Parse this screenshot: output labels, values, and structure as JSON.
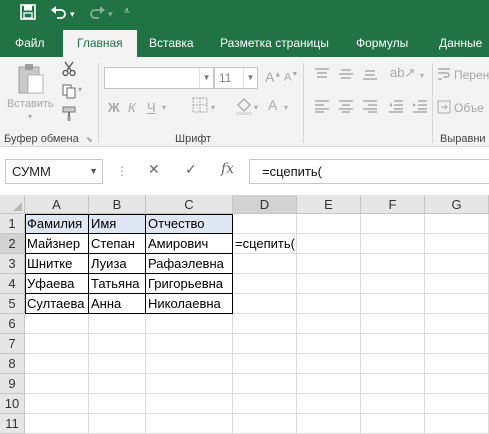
{
  "quick_access": {
    "save": "save-icon",
    "undo": "undo-icon",
    "redo": "redo-icon",
    "customize": "customize-icon"
  },
  "tabs": [
    "Файл",
    "Главная",
    "Вставка",
    "Разметка страницы",
    "Формулы",
    "Данные"
  ],
  "active_tab": "Главная",
  "ribbon": {
    "clipboard": {
      "paste_label": "Вставить",
      "group_label": "Буфер обмена"
    },
    "font": {
      "font_name": "",
      "font_size": "11",
      "bold": "Ж",
      "italic": "К",
      "underline": "Ч",
      "group_label": "Шрифт"
    },
    "alignment": {
      "wrap_label": "Перен",
      "merge_label": "Объе",
      "group_label": "Выравни"
    }
  },
  "formula_bar": {
    "name_box": "СУММ",
    "cancel": "✕",
    "enter": "✓",
    "fx": "fx",
    "formula": "=сцепить("
  },
  "columns": [
    "A",
    "B",
    "C",
    "D",
    "E",
    "F",
    "G"
  ],
  "rows": [
    "1",
    "2",
    "3",
    "4",
    "5",
    "6",
    "7",
    "8",
    "9",
    "10",
    "11"
  ],
  "cells": {
    "A1": "Фамилия",
    "B1": "Имя",
    "C1": "Отчество",
    "A2": "Майзнер",
    "B2": "Степан",
    "C2": "Амирович",
    "D2": "=сцепить(",
    "A3": "Шнитке",
    "B3": "Луиза",
    "C3": "Рафаэлевна",
    "A4": "Уфаева",
    "B4": "Татьяна",
    "C4": "Григорьевна",
    "A5": "Султаева",
    "B5": "Анна",
    "C5": "Николаевна"
  },
  "colors": {
    "excel_green": "#217346",
    "header_highlight": "#dfe6f4"
  }
}
